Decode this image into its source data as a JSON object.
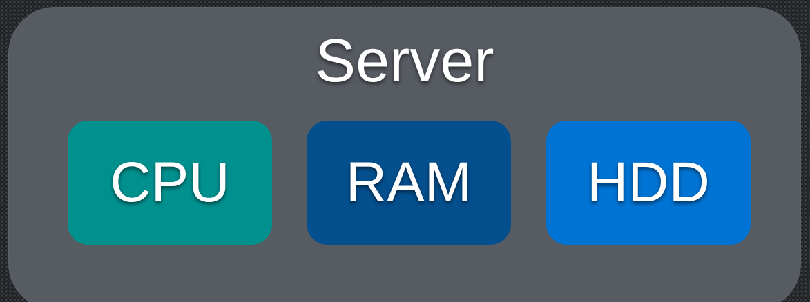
{
  "server": {
    "title": "Server",
    "background": "#575b62"
  },
  "components": [
    {
      "label": "CPU",
      "color": "#00918f"
    },
    {
      "label": "RAM",
      "color": "#04508f"
    },
    {
      "label": "HDD",
      "color": "#0074d4"
    }
  ]
}
